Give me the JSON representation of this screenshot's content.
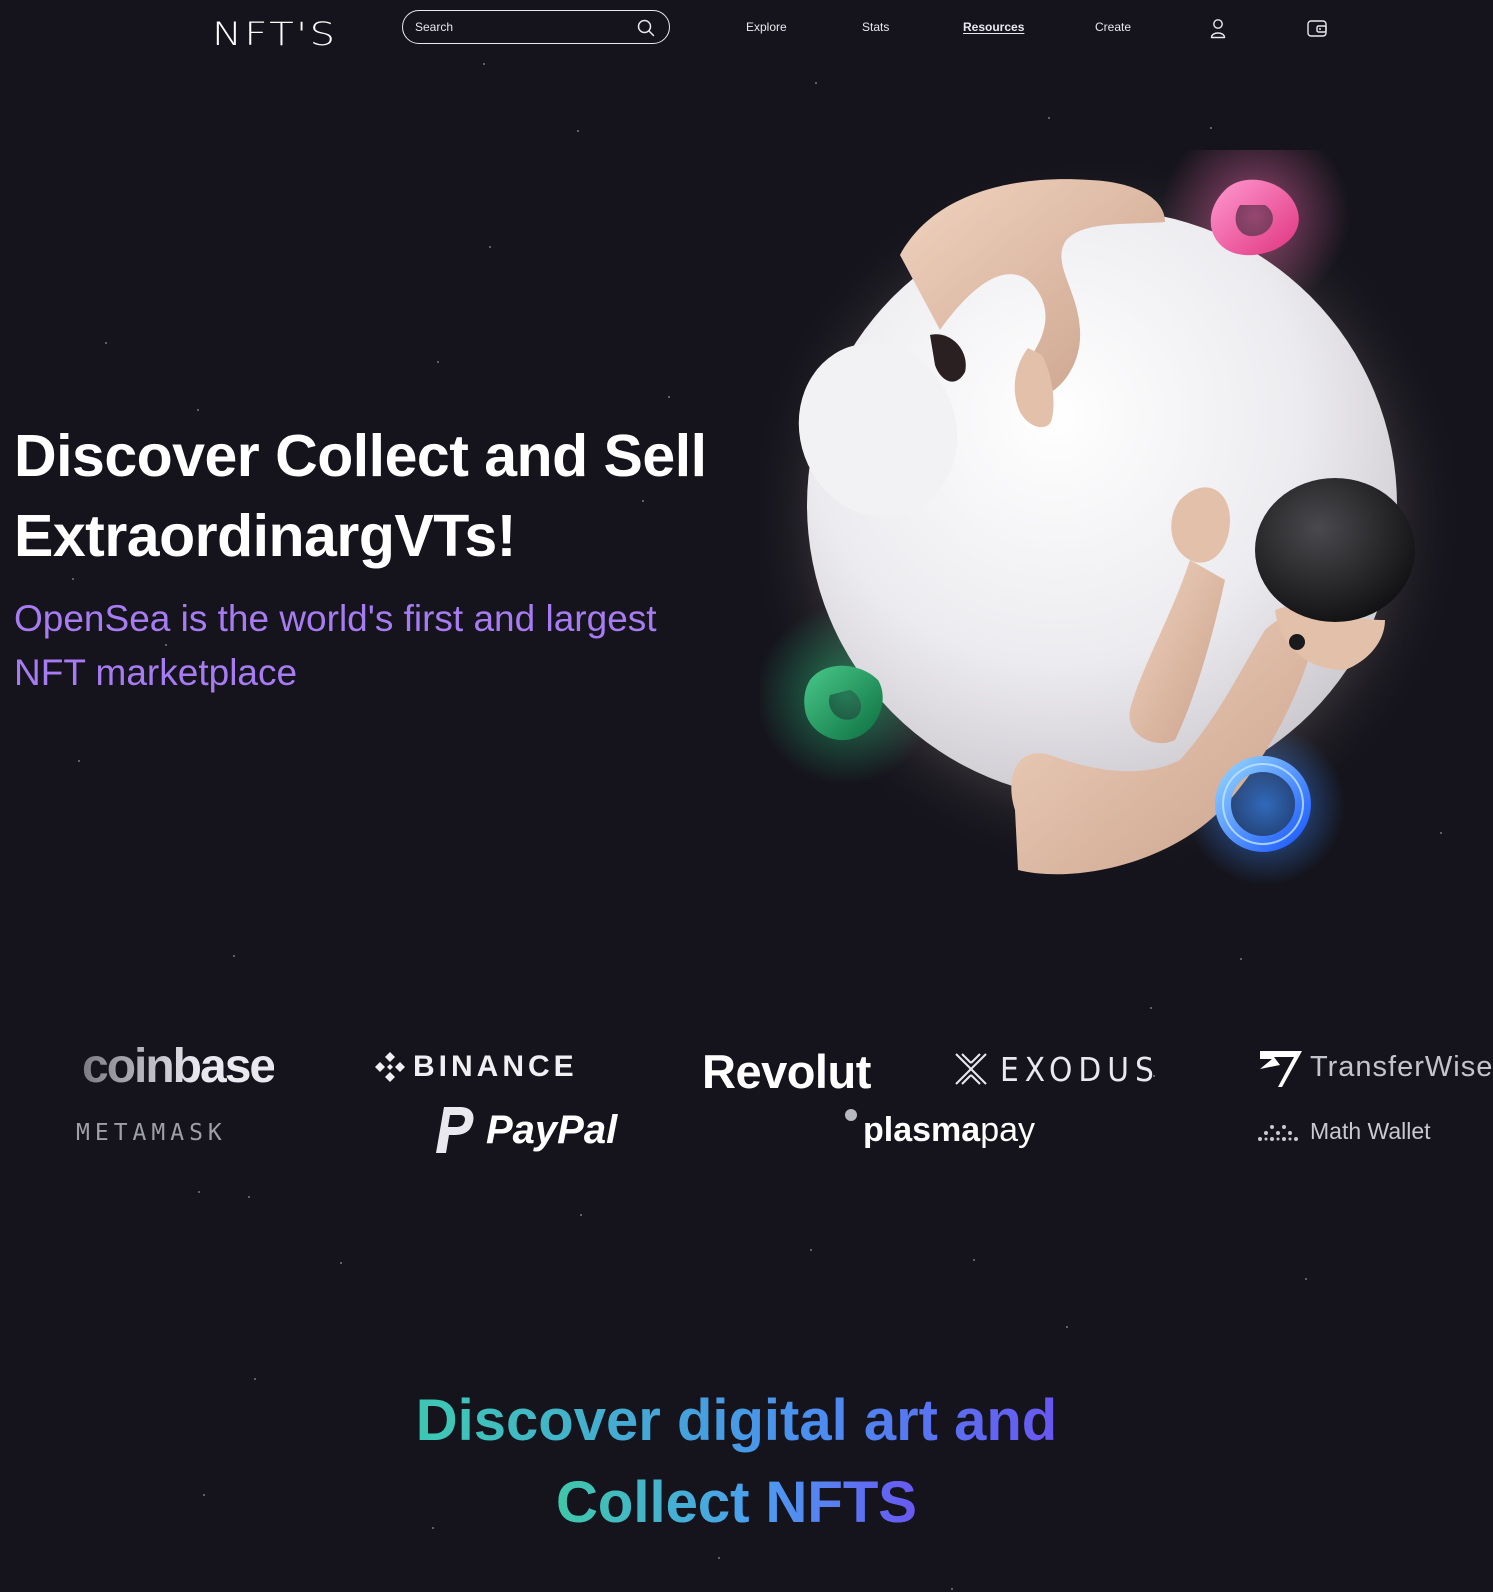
{
  "header": {
    "logo_text": "NFT'S",
    "search": {
      "placeholder": "Search",
      "value": ""
    },
    "nav": [
      {
        "label": "Explore",
        "active": false
      },
      {
        "label": "Stats",
        "active": false
      },
      {
        "label": "Resources",
        "active": true
      },
      {
        "label": "Create",
        "active": false
      }
    ],
    "icons": [
      "search-icon",
      "user-icon",
      "wallet-icon"
    ]
  },
  "hero": {
    "title_line1": "Discover Collect and Sell",
    "title_line2": "ExtraordinargVTs!",
    "subtitle_line1": "OpenSea is the world's first and largest",
    "subtitle_line2": "NFT marketplace"
  },
  "partners": {
    "row1": [
      "coinbase",
      "BINANCE",
      "Revolut",
      "EXODUS",
      "TransferWise"
    ],
    "row2": [
      "METAMASK",
      "PayPal",
      "plasma",
      "pay",
      "Math Wallet"
    ]
  },
  "section": {
    "heading_line1": "Discover digital art and",
    "heading_line2": "Collect NFTS"
  },
  "colors": {
    "background": "#15141c",
    "accent_purple": "#a77cf2",
    "gradient_green": "#3fd39b",
    "gradient_blue": "#4a8ff0",
    "gradient_violet": "#7b3df5"
  }
}
